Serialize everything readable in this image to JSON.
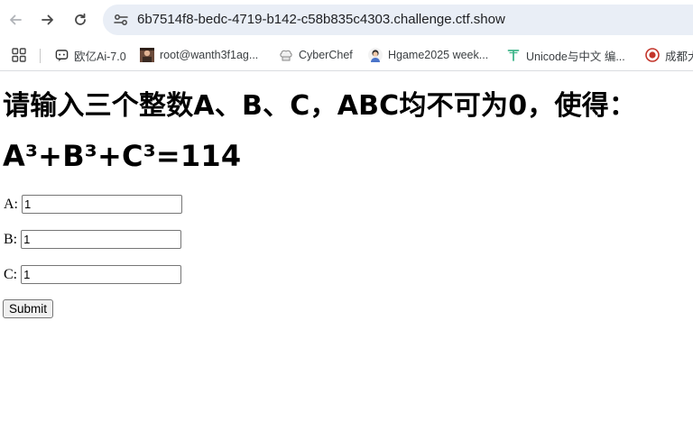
{
  "browser": {
    "url": "6b7514f8-bedc-4719-b142-c58b835c4303.challenge.ctf.show",
    "bookmarks": [
      {
        "label": "欧亿Ai-7.0",
        "icon": "chat-bubble-icon"
      },
      {
        "label": "root@wanth3f1ag...",
        "icon": "avatar-photo-icon"
      },
      {
        "label": "CyberChef",
        "icon": "chef-hat-icon"
      },
      {
        "label": "Hgame2025 week...",
        "icon": "person-avatar-icon"
      },
      {
        "label": "Unicode与中文 编...",
        "icon": "letter-t-icon"
      },
      {
        "label": "成都大",
        "icon": "red-badge-icon"
      }
    ]
  },
  "page": {
    "heading": "请输入三个整数A、B、C，ABC均不可为0，使得：",
    "equation": "A³+B³+C³=114",
    "fields": [
      {
        "label": "A:",
        "value": "1"
      },
      {
        "label": "B:",
        "value": "1"
      },
      {
        "label": "C:",
        "value": "1"
      }
    ],
    "submit_label": "Submit"
  }
}
